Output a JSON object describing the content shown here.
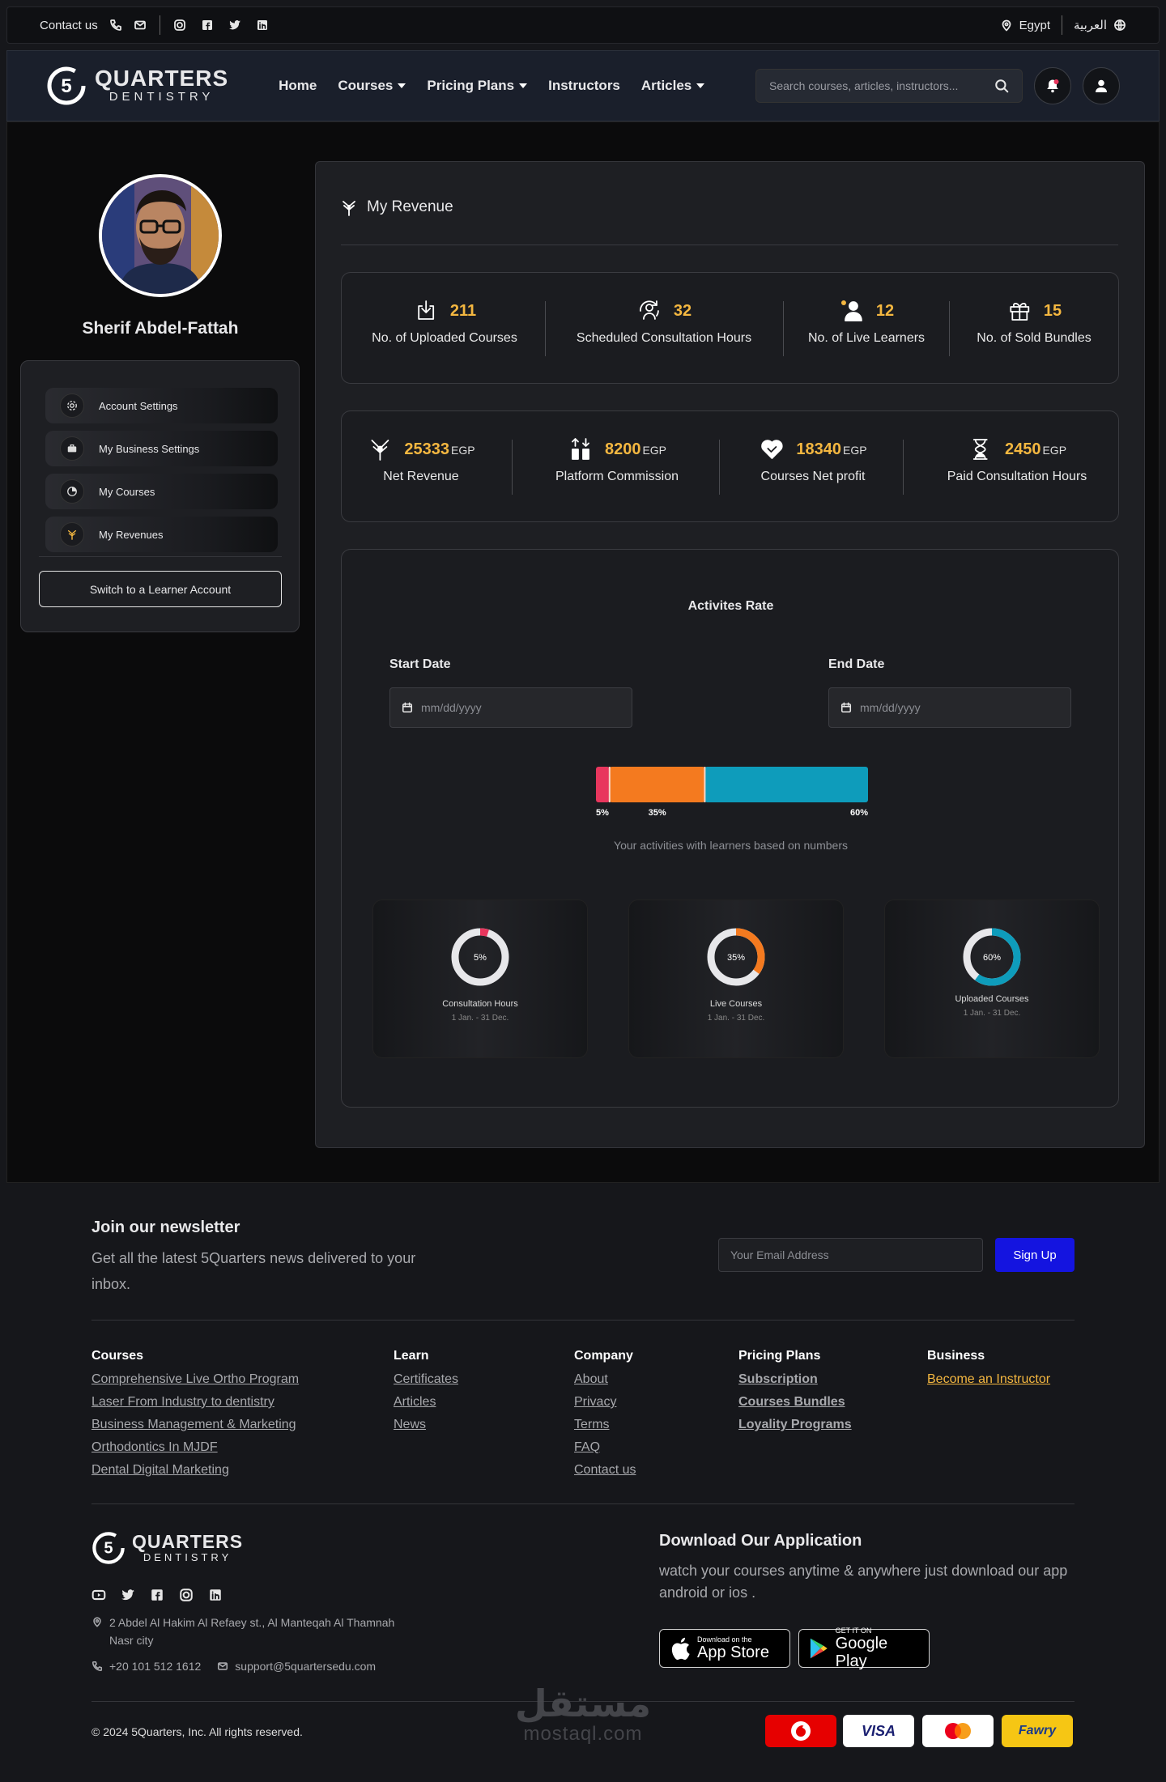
{
  "topbar": {
    "contact": "Contact us",
    "country": "Egypt",
    "language": "العربية"
  },
  "nav": {
    "brand_top": "QUARTERS",
    "brand_bottom": "DENTISTRY",
    "brand_digit": "5",
    "links": [
      "Home",
      "Courses",
      "Pricing Plans",
      "Instructors",
      "Articles"
    ],
    "search_placeholder": "Search courses, articles, instructors..."
  },
  "profile": {
    "name": "Sherif Abdel-Fattah",
    "menu": [
      "Account Settings",
      "My Business Settings",
      "My Courses",
      "My Revenues"
    ],
    "switch_button": "Switch to a Learner Account"
  },
  "revenue": {
    "title": "My Revenue",
    "stats": [
      {
        "value": "211",
        "label": "No. of Uploaded Courses"
      },
      {
        "value": "32",
        "label": "Scheduled Consultation Hours"
      },
      {
        "value": "12",
        "label": "No. of Live Learners"
      },
      {
        "value": "15",
        "label": "No. of Sold Bundles"
      }
    ],
    "money": [
      {
        "value": "25333",
        "unit": "EGP",
        "label": "Net Revenue"
      },
      {
        "value": "8200",
        "unit": "EGP",
        "label": "Platform Commission"
      },
      {
        "value": "18340",
        "unit": "EGP",
        "label": "Courses Net profit"
      },
      {
        "value": "2450",
        "unit": "EGP",
        "label": "Paid Consultation Hours"
      }
    ]
  },
  "activities": {
    "title": "Activites Rate",
    "start_label": "Start Date",
    "end_label": "End Date",
    "date_placeholder": "mm/dd/yyyy",
    "caption": "Your activities with learners based on numbers",
    "colors": {
      "consultation": "#e8365d",
      "live": "#f47a1f",
      "uploaded": "#0e9cbb"
    },
    "bar_labels": [
      "5%",
      "35%",
      "60%"
    ],
    "donuts": [
      {
        "pct": "5%",
        "name": "Consultation Hours",
        "range": "1 Jan. - 31 Dec."
      },
      {
        "pct": "35%",
        "name": "Live Courses",
        "range": "1 Jan. - 31 Dec."
      },
      {
        "pct": "60%",
        "name": "Uploaded Courses",
        "range": "1 Jan. - 31 Dec."
      }
    ]
  },
  "chart_data": {
    "type": "bar",
    "categories": [
      "Consultation Hours",
      "Live Courses",
      "Uploaded Courses"
    ],
    "values": [
      5,
      35,
      60
    ],
    "unit": "%"
  },
  "footer": {
    "newsletter_title": "Join our newsletter",
    "newsletter_text": "Get all the latest 5Quarters news delivered to your inbox.",
    "email_placeholder": "Your Email Address",
    "signup": "Sign Up",
    "cols": [
      {
        "title": "Courses",
        "links": [
          "Comprehensive Live Ortho Program",
          "Laser From Industry to dentistry",
          "Business Management & Marketing",
          "Orthodontics In MJDF",
          "Dental Digital Marketing"
        ]
      },
      {
        "title": "Learn",
        "links": [
          "Certificates",
          "Articles",
          "News"
        ]
      },
      {
        "title": "Company",
        "links": [
          "About",
          "Privacy",
          "Terms",
          "FAQ",
          "Contact us"
        ]
      },
      {
        "title": "Pricing Plans",
        "links": [
          "Subscription",
          "Courses Bundles",
          "Loyality Programs"
        ]
      },
      {
        "title": "Business",
        "links": [
          "Become an Instructor"
        ]
      }
    ],
    "address": "2 Abdel Al Hakim Al Refaey st., Al Manteqah Al Thamnah Nasr city",
    "phone": "+20 101 512 1612",
    "email": "support@5quartersedu.com",
    "app_title": "Download  Our Application",
    "app_text": "watch your courses anytime & anywhere just download our app android or ios .",
    "appstore_small": "Download on the",
    "appstore_big": "App Store",
    "gplay_small": "GET IT ON",
    "gplay_big": "Google Play",
    "copyright": "© 2024 5Quarters, Inc. All rights reserved.",
    "payments": [
      "VISA",
      "Fawry"
    ],
    "watermark_ar": "مستقل",
    "watermark_en": "mostaql.com"
  }
}
